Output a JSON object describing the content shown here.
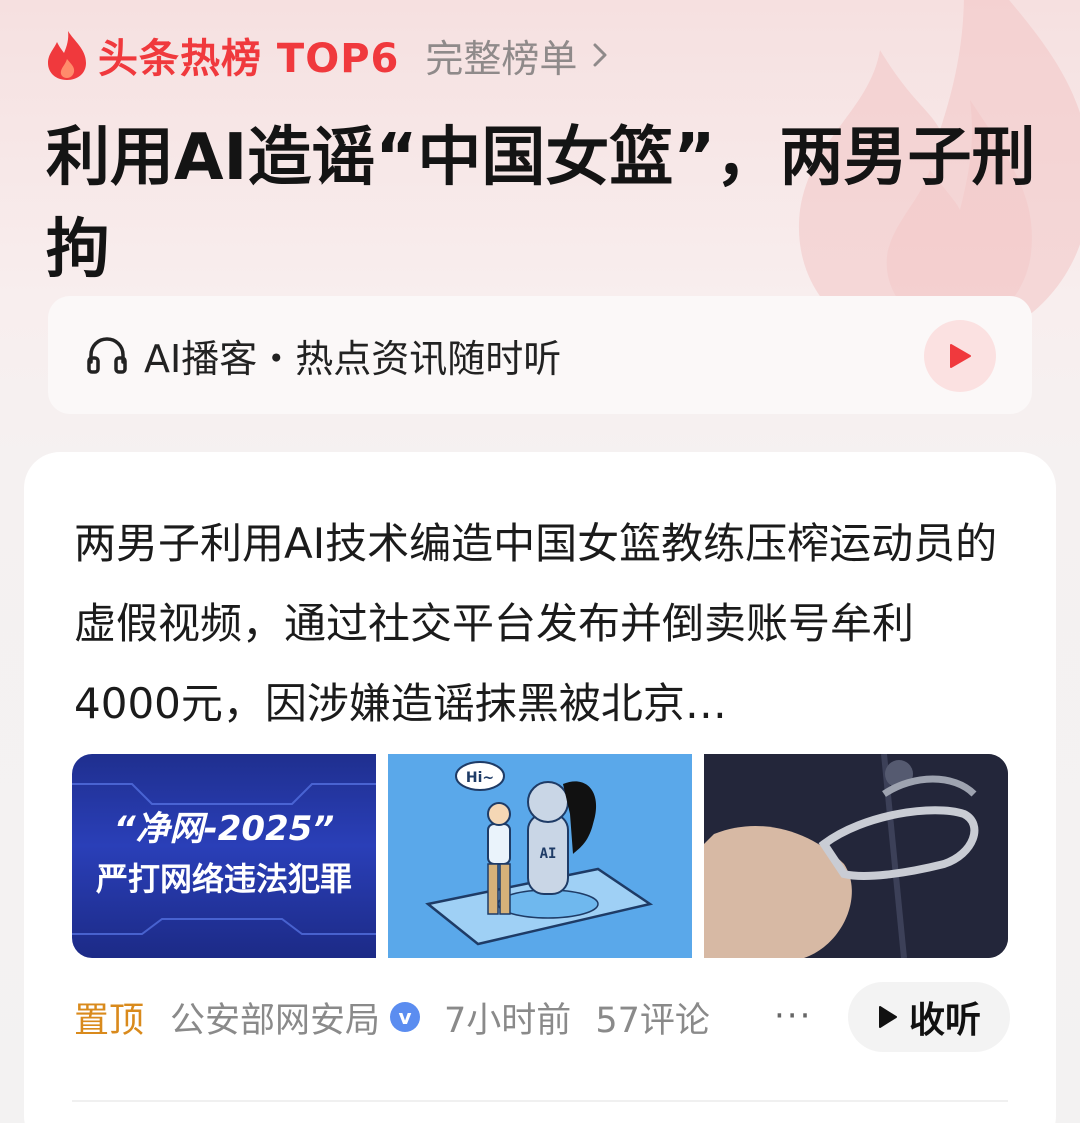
{
  "hot_list": {
    "title": "头条热榜 TOP6",
    "full_list_label": "完整榜单"
  },
  "headline": "利用AI造谣“中国女篮”，两男子刑拘",
  "podcast": {
    "label": "AI播客・热点资讯随时听"
  },
  "article": {
    "summary": "两男子利用AI技术编造中国女篮教练压榨运动员的虚假视频，通过社交平台发布并倒卖账号牟利4000元，因涉嫌造谣抹黑被北京…",
    "images": [
      {
        "text_line1": "“净网-2025”",
        "text_line2": "严打网络违法犯罪"
      },
      {
        "bubble": "Hi~",
        "robot_label": "AI"
      },
      {
        "desc": "handcuffs"
      }
    ],
    "pin_label": "置顶",
    "source": "公安部网安局",
    "verified_mark": "v",
    "time": "7小时前",
    "comments": "57评论",
    "more": "···",
    "listen_label": "收听"
  },
  "colors": {
    "accent": "#f0393d",
    "pin": "#d98a1c",
    "verified": "#5b8df0"
  },
  "icons": [
    "fire-icon",
    "chevron-right-icon",
    "headphones-icon",
    "play-icon",
    "verified-icon",
    "more-icon",
    "play-triangle-icon"
  ]
}
